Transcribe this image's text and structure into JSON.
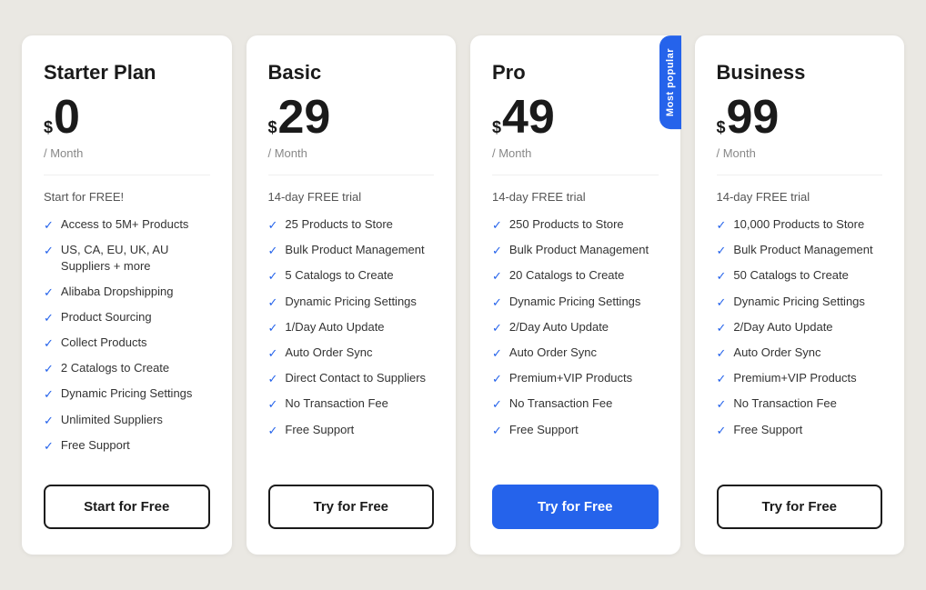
{
  "plans": [
    {
      "id": "starter",
      "name": "Starter Plan",
      "price": "0",
      "period": "/ Month",
      "intro": "Start for FREE!",
      "featured": false,
      "badge": null,
      "cta": "Start for Free",
      "cta_style": "default",
      "features": [
        "Access to 5M+ Products",
        "US, CA, EU, UK, AU Suppliers + more",
        "Alibaba Dropshipping",
        "Product Sourcing",
        "Collect Products",
        "2 Catalogs to Create",
        "Dynamic Pricing Settings",
        "Unlimited Suppliers",
        "Free Support"
      ]
    },
    {
      "id": "basic",
      "name": "Basic",
      "price": "29",
      "period": "/ Month",
      "intro": "14-day FREE trial",
      "featured": false,
      "badge": null,
      "cta": "Try for Free",
      "cta_style": "default",
      "features": [
        "25 Products to Store",
        "Bulk Product Management",
        "5 Catalogs to Create",
        "Dynamic Pricing Settings",
        "1/Day Auto Update",
        "Auto Order Sync",
        "Direct Contact to Suppliers",
        "No Transaction Fee",
        "Free Support"
      ]
    },
    {
      "id": "pro",
      "name": "Pro",
      "price": "49",
      "period": "/ Month",
      "intro": "14-day FREE trial",
      "featured": true,
      "badge": "Most popular",
      "cta": "Try for Free",
      "cta_style": "featured",
      "features": [
        "250 Products to Store",
        "Bulk Product Management",
        "20 Catalogs to Create",
        "Dynamic Pricing Settings",
        "2/Day Auto Update",
        "Auto Order Sync",
        "Premium+VIP Products",
        "No Transaction Fee",
        "Free Support"
      ]
    },
    {
      "id": "business",
      "name": "Business",
      "price": "99",
      "period": "/ Month",
      "intro": "14-day FREE trial",
      "featured": false,
      "badge": null,
      "cta": "Try for Free",
      "cta_style": "default",
      "features": [
        "10,000 Products to Store",
        "Bulk Product Management",
        "50 Catalogs to Create",
        "Dynamic Pricing Settings",
        "2/Day Auto Update",
        "Auto Order Sync",
        "Premium+VIP Products",
        "No Transaction Fee",
        "Free Support"
      ]
    }
  ],
  "check_symbol": "✓"
}
